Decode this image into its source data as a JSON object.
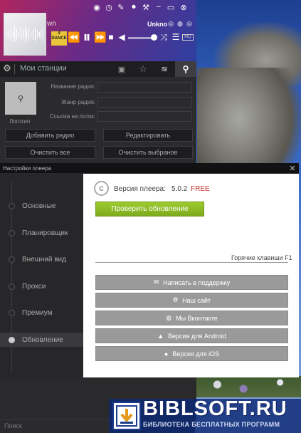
{
  "player": {
    "track_fragment": "wn",
    "artist_fragment": "Unkno",
    "dance_badge": "4 DANCE",
    "quality_badge": "MQ",
    "volume_percent": 85
  },
  "stations": {
    "label": "Мои станции"
  },
  "radio_form": {
    "logo_label": "Логотип",
    "name_label": "Название радио:",
    "genre_label": "Жанр радио:",
    "stream_label": "Ссылка на поток:",
    "add_label": "Добавить радио",
    "edit_label": "Редактировать",
    "clear_all_label": "Очистить все",
    "clear_selected_label": "Очистить выбраное"
  },
  "settings": {
    "title": "Настройки плеера",
    "close": "✕",
    "nav": [
      {
        "label": "Основные"
      },
      {
        "label": "Планировщик"
      },
      {
        "label": "Внешний вид"
      },
      {
        "label": "Прокси"
      },
      {
        "label": "Премиум"
      },
      {
        "label": "Обновление"
      }
    ],
    "version_label": "Версия плеера:",
    "version_number": "5.0.2",
    "version_free": "FREE",
    "check_update": "Проверить обновление",
    "hotkeys": "Горячие клавиши F1",
    "buttons": [
      {
        "label": "Написать в поддержку",
        "icon": "mail-icon"
      },
      {
        "label": "Наш сайт",
        "icon": "globe-icon"
      },
      {
        "label": "Мы Вконтакте",
        "icon": "vk-icon"
      },
      {
        "label": "Версия для Android",
        "icon": "android-icon"
      },
      {
        "label": "Версия для iOS",
        "icon": "apple-icon"
      }
    ]
  },
  "bottom": {
    "search_label": "Поиск"
  },
  "watermark": {
    "title": "BIBLSOFT.RU",
    "subtitle": "БИБЛИОТЕКА БЕСПЛАТНЫХ ПРОГРАММ"
  },
  "colors": {
    "update_green": "#8bbb22",
    "free_red": "#c83030",
    "gray_button": "#9a9a9a"
  }
}
